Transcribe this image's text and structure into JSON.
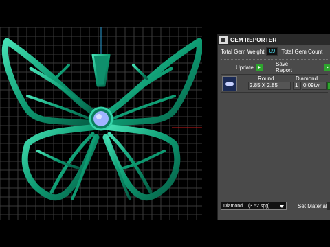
{
  "panel": {
    "title": "GEM REPORTER",
    "total_gem_weight_label": "Total Gem Weight",
    "total_gem_weight_value": "09",
    "total_gem_count_label": "Total Gem Count",
    "update_label": "Update",
    "save_report_label": "Save Report"
  },
  "gem_table": {
    "shape_header": "Round",
    "type_header": "Diamond",
    "size": "2.85 X 2.85",
    "count": "1",
    "weight": "0.09tw"
  },
  "material": {
    "selected": "Diamond",
    "sg": "(3.52 spg)",
    "set_label": "Set Material"
  },
  "colors": {
    "viewport_bg": "#000000",
    "grid": "#3a3a3a",
    "gem_green": "#0fa07a",
    "accent_blue": "#2aa0d8",
    "panel_bg": "#4a4a4a"
  },
  "icons": [
    "gem-reporter-icon",
    "play-arrow-icon",
    "gem-thumbnail-icon",
    "dropdown-caret-icon"
  ]
}
